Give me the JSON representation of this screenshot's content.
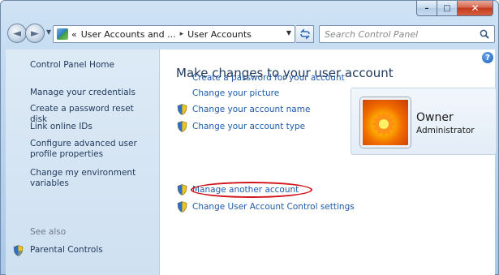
{
  "window": {
    "caption_buttons": {
      "minimize": "–",
      "maximize": "□",
      "close": "✕"
    }
  },
  "navigation": {
    "back_icon": "back-arrow-icon",
    "forward_icon": "forward-arrow-icon",
    "address": {
      "overflow": "«",
      "segment_1": "User Accounts and ...",
      "separator": "▸",
      "segment_2": "User Accounts"
    },
    "search": {
      "placeholder": "Search Control Panel"
    }
  },
  "sidebar": {
    "home": "Control Panel Home",
    "items": [
      "Manage your credentials",
      "Create a password reset disk",
      "Link online IDs",
      "Configure advanced user profile properties",
      "Change my environment variables"
    ],
    "see_also_label": "See also",
    "see_also_items": [
      "Parental Controls"
    ]
  },
  "main": {
    "title": "Make changes to your user account",
    "tasks": [
      {
        "label": "Create a password for your account",
        "shield": false
      },
      {
        "label": "Change your picture",
        "shield": false
      },
      {
        "label": "Change your account name",
        "shield": true
      },
      {
        "label": "Change your account type",
        "shield": true
      }
    ],
    "tasks_2": [
      {
        "label": "Manage another account",
        "shield": true,
        "highlighted": true
      },
      {
        "label": "Change User Account Control settings",
        "shield": true
      }
    ],
    "help": "?"
  },
  "user": {
    "name": "Owner",
    "role": "Administrator"
  },
  "colors": {
    "link": "#1e5aa8",
    "highlight_ellipse": "#d0121b"
  }
}
